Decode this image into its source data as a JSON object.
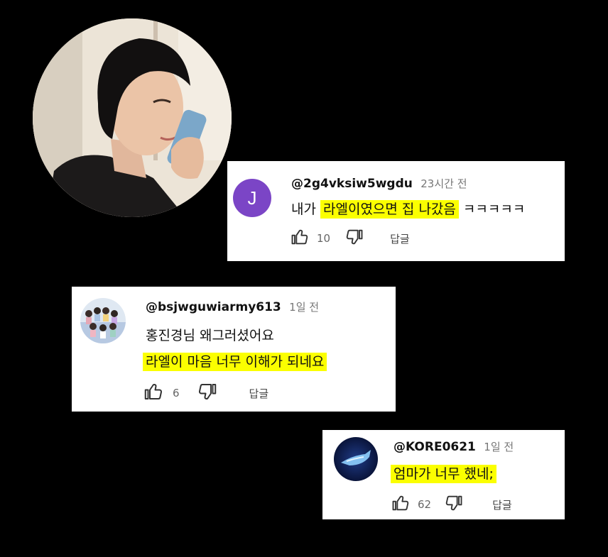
{
  "comments": [
    {
      "handle": "@2g4vksiw5wgdu",
      "time": "23시간 전",
      "avatar_letter": "J",
      "text_before": "내가 ",
      "text_highlight": "라엘이였으면 집 나갔음",
      "text_after": " ㅋㅋㅋㅋㅋ",
      "likes": "10",
      "reply_label": "답글"
    },
    {
      "handle": "@bsjwguwiarmy613",
      "time": "1일 전",
      "line1": "홍진경님 왜그러셨어요",
      "line2_highlight": "라엘이 마음 너무 이해가 되네요",
      "likes": "6",
      "reply_label": "답글"
    },
    {
      "handle": "@KORE0621",
      "time": "1일 전",
      "text_highlight": "엄마가 너무 했네;",
      "likes": "62",
      "reply_label": "답글"
    }
  ],
  "colors": {
    "highlight": "#fbff00",
    "avatar_j": "#7b45c6",
    "background": "#000000"
  }
}
